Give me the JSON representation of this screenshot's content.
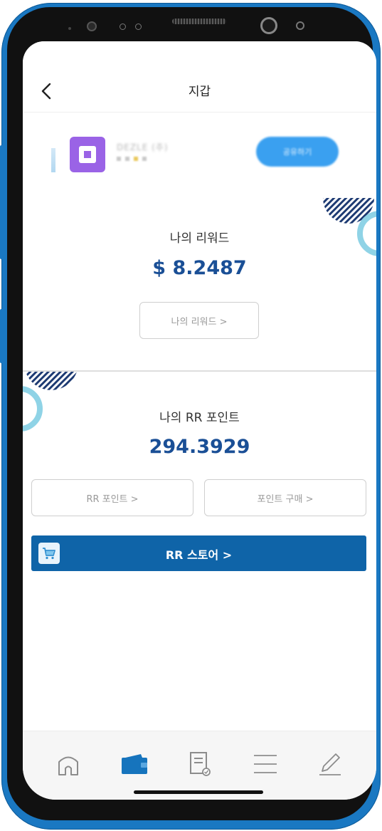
{
  "header": {
    "title": "지갑",
    "back_icon": "chevron-left-icon"
  },
  "profile": {
    "name_blurred": "DEZLE (주)",
    "action_blurred": "공유하기"
  },
  "rewards": {
    "label": "나의 리워드",
    "value": "$ 8.2487",
    "button_label": "나의 리워드 >"
  },
  "rr_points": {
    "label": "나의 RR 포인트",
    "value": "294.3929",
    "button_points_label": "RR 포인트 >",
    "button_buy_label": "포인트 구매 >"
  },
  "store": {
    "label": "RR 스토어 >",
    "icon": "cart-icon"
  },
  "bottom_nav": {
    "items": [
      {
        "icon": "home-icon",
        "active": false
      },
      {
        "icon": "wallet-icon",
        "active": true
      },
      {
        "icon": "document-icon",
        "active": false
      },
      {
        "icon": "menu-icon",
        "active": false
      },
      {
        "icon": "pencil-icon",
        "active": false
      }
    ]
  },
  "colors": {
    "phone_frame": "#1a78c2",
    "accent_blue": "#0f64a8",
    "value_blue": "#1a4f96",
    "deco_navy": "#1d3a72",
    "deco_cyan": "#8fd3e6"
  }
}
